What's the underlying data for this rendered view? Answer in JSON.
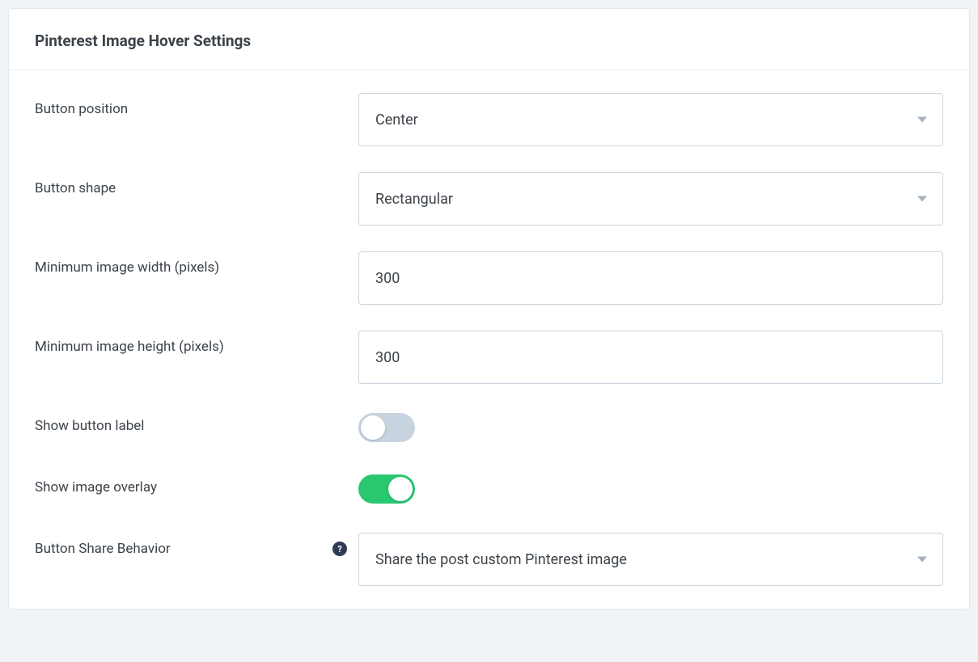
{
  "panel": {
    "title": "Pinterest Image Hover Settings"
  },
  "fields": {
    "button_position": {
      "label": "Button position",
      "value": "Center"
    },
    "button_shape": {
      "label": "Button shape",
      "value": "Rectangular"
    },
    "min_width": {
      "label": "Minimum image width (pixels)",
      "value": "300"
    },
    "min_height": {
      "label": "Minimum image height (pixels)",
      "value": "300"
    },
    "show_button_label": {
      "label": "Show button label",
      "value": false
    },
    "show_image_overlay": {
      "label": "Show image overlay",
      "value": true
    },
    "button_share_behavior": {
      "label": "Button Share Behavior",
      "value": "Share the post custom Pinterest image",
      "help": "?"
    }
  }
}
